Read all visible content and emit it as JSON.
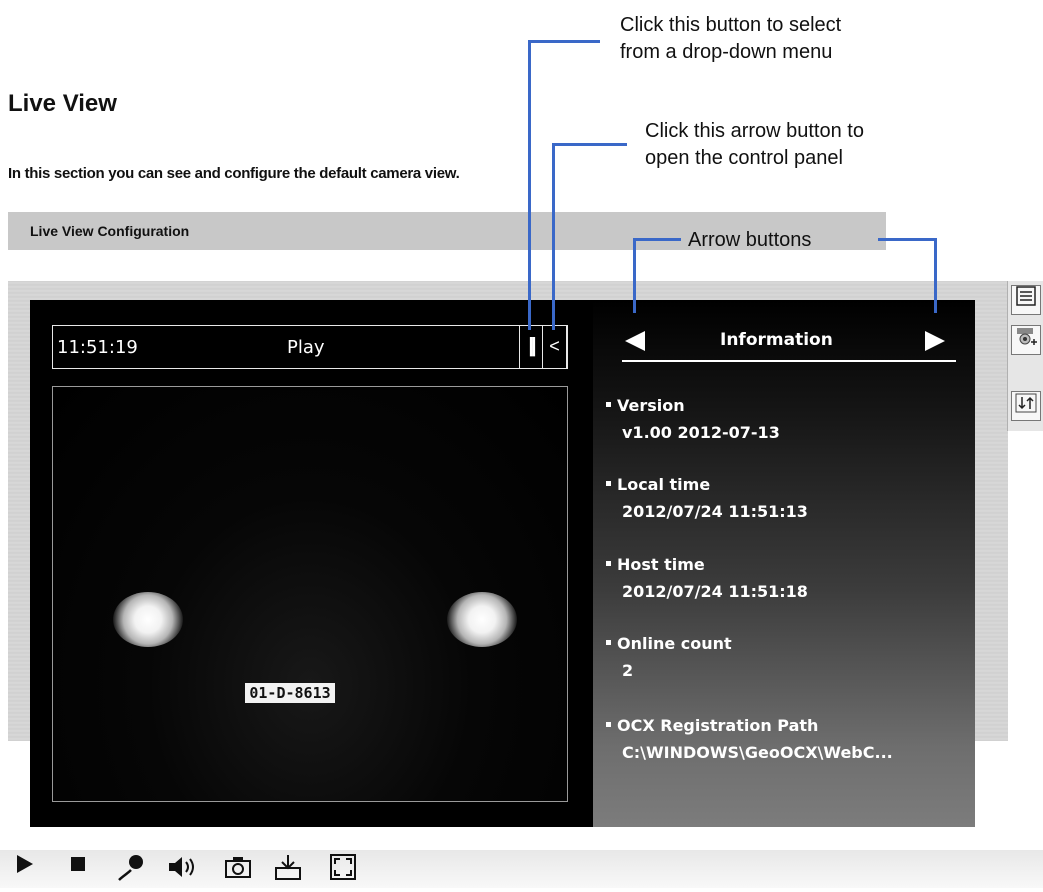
{
  "page": {
    "title": "Live View",
    "subtitle": "In this section you can see and configure the default camera view.",
    "section_label": "Live View Configuration"
  },
  "callouts": {
    "dropdown": "Click this button to select from a drop-down menu",
    "dropdown_line1": "Click this button to select",
    "dropdown_line2": "from a drop-down menu",
    "control_line1": "Click this arrow button to",
    "control_line2": "open the control panel",
    "arrows": "Arrow buttons"
  },
  "viewer": {
    "time": "11:51:19",
    "status": "Play",
    "menu_button_glyph": "||",
    "panel_button_glyph": "<",
    "plate_text": "01-D-8613"
  },
  "info": {
    "title": "Information",
    "items": [
      {
        "label": "Version",
        "value": "v1.00  2012-07-13"
      },
      {
        "label": "Local time",
        "value": "2012/07/24 11:51:13"
      },
      {
        "label": "Host time",
        "value": "2012/07/24 11:51:18"
      },
      {
        "label": "Online count",
        "value": "2"
      },
      {
        "label": "OCX Registration Path",
        "value": "C:\\WINDOWS\\GeoOCX\\WebC..."
      }
    ]
  },
  "toolbar": {
    "icons": [
      "play-icon",
      "stop-icon",
      "microphone-icon",
      "speaker-icon",
      "snapshot-icon",
      "record-icon",
      "fullscreen-icon"
    ]
  },
  "side_tools": {
    "icons": [
      "list-icon",
      "ptz-camera-icon",
      "io-icon"
    ]
  },
  "colors": {
    "callout_line": "#3a68c8",
    "section_bar": "#c8c8c8",
    "viewer_bg": "#000000"
  }
}
